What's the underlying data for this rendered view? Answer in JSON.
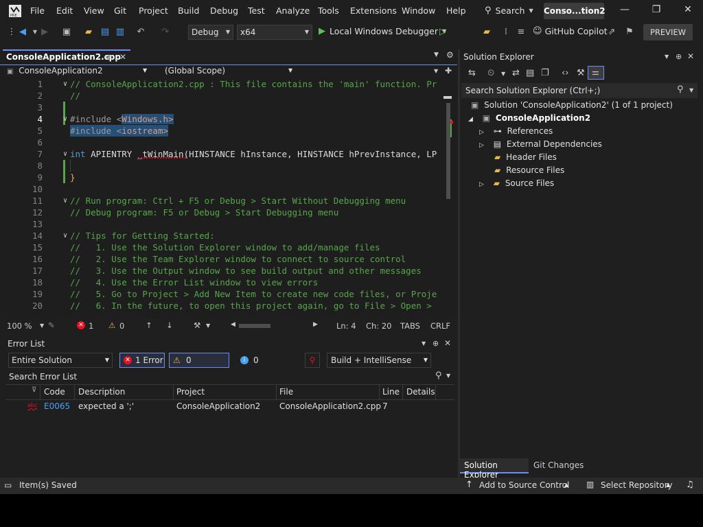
{
  "menu": [
    "File",
    "Edit",
    "View",
    "Git",
    "Project",
    "Build",
    "Debug",
    "Test",
    "Analyze",
    "Tools",
    "Extensions",
    "Window",
    "Help"
  ],
  "search_label": "Search",
  "window_title": "Conso...tion2",
  "toolbar": {
    "config": "Debug",
    "platform": "x64",
    "run_label": "Local Windows Debugger",
    "copilot_label": "GitHub Copilot",
    "preview_label": "PREVIEW"
  },
  "editor": {
    "tab_name": "ConsoleApplication2.cpp",
    "project_combo": "ConsoleApplication2",
    "scope_combo": "(Global Scope)",
    "line_numbers": [
      "1",
      "2",
      "3",
      "4",
      "5",
      "6",
      "7",
      "8",
      "9",
      "10",
      "11",
      "12",
      "13",
      "14",
      "15",
      "16",
      "17",
      "18",
      "19",
      "20"
    ],
    "lines": {
      "l1": "// ConsoleApplication2.cpp : This file contains the 'main' function. Pr",
      "l2": "//",
      "l4a": "#include <",
      "l4b": "Windows.h",
      "l4c": ">",
      "l5a": "#include <",
      "l5b": "iostream",
      "l5c": ">",
      "l7a": "int",
      "l7b": " APIENTRY _tWinMain(HINSTANCE hInstance, HINSTANCE hPrevInstance, LP",
      "l9": "}",
      "l11": "// Run program: Ctrl + F5 or Debug > Start Without Debugging menu",
      "l12": "// Debug program: F5 or Debug > Start Debugging menu",
      "l14": "// Tips for Getting Started:",
      "l15": "//   1. Use the Solution Explorer window to add/manage files",
      "l16": "//   2. Use the Team Explorer window to connect to source control",
      "l17": "//   3. Use the Output window to see build output and other messages",
      "l18": "//   4. Use the Error List window to view errors",
      "l19": "//   5. Go to Project > Add New Item to create new code files, or Proje",
      "l20": "//   6. In the future, to open this project again, go to File > Open >"
    },
    "zoom": "100 %",
    "errors": "1",
    "warnings": "0",
    "ln": "Ln: 4",
    "ch": "Ch: 20",
    "tabs": "TABS",
    "eol": "CRLF"
  },
  "error_list": {
    "title": "Error List",
    "scope": "Entire Solution",
    "errors_btn": "1 Error",
    "warnings_btn": "0 Warnings",
    "messages_btn": "0 Messages",
    "build_filter": "Build + IntelliSense",
    "search_placeholder": "Search Error List",
    "columns": [
      "Code",
      "Description",
      "Project",
      "File",
      "Line",
      "Details"
    ],
    "rows": [
      {
        "code": "E0065",
        "description": "expected a ';'",
        "project": "ConsoleApplication2",
        "file": "ConsoleApplication2.cpp",
        "line": "7",
        "details": ""
      }
    ]
  },
  "solution_explorer": {
    "title": "Solution Explorer",
    "search_placeholder": "Search Solution Explorer (Ctrl+;)",
    "solution": "Solution 'ConsoleApplication2' (1 of 1 project)",
    "project": "ConsoleApplication2",
    "items": [
      "References",
      "External Dependencies",
      "Header Files",
      "Resource Files",
      "Source Files"
    ],
    "tabs": [
      "Solution Explorer",
      "Git Changes"
    ]
  },
  "statusbar": {
    "message": "Item(s) Saved",
    "source_control": "Add to Source Control",
    "repository": "Select Repository"
  },
  "colors": {
    "accent": "#6b8ff7",
    "comment": "#57a64a",
    "keyword": "#569cd6",
    "string": "#d69d85",
    "error": "#e81123",
    "selection": "#264f78"
  }
}
